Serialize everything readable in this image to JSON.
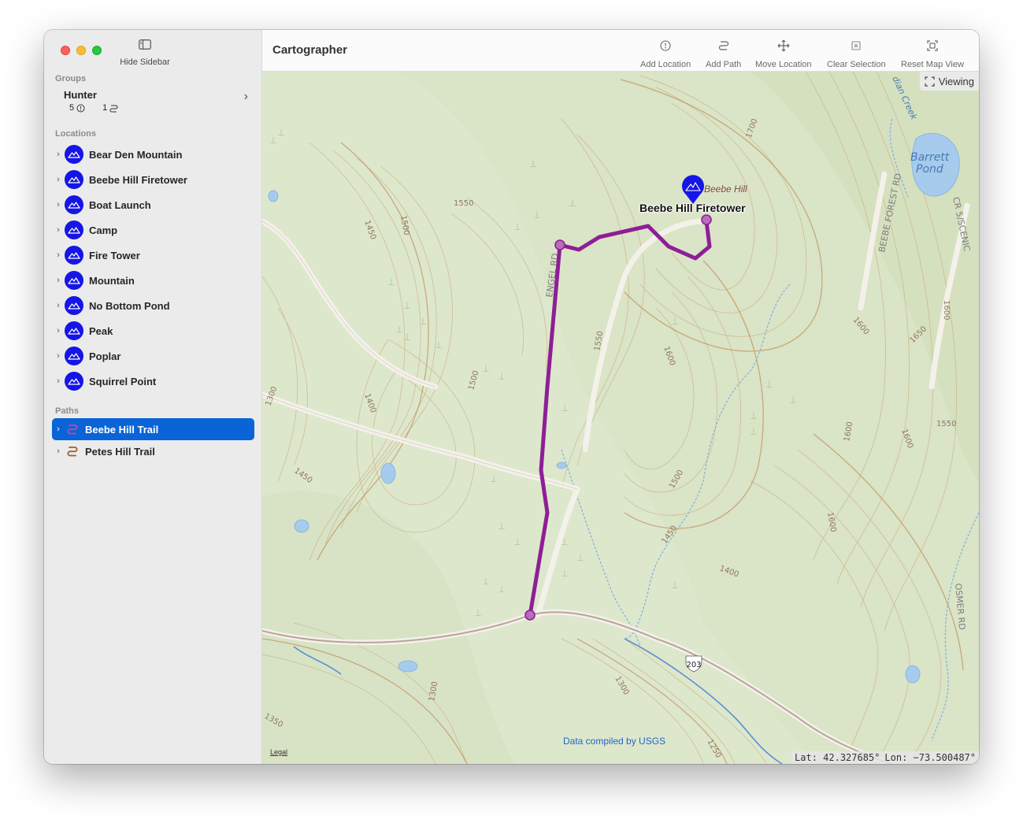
{
  "window": {
    "traffic_lights": [
      "close",
      "minimize",
      "zoom"
    ]
  },
  "sidebar": {
    "toggle_label": "Hide Sidebar",
    "groups_header": "Groups",
    "group": {
      "name": "Hunter",
      "location_count": "5",
      "path_count": "1"
    },
    "locations_header": "Locations",
    "locations": [
      {
        "label": "Bear Den Mountain"
      },
      {
        "label": "Beebe Hill Firetower"
      },
      {
        "label": "Boat Launch"
      },
      {
        "label": "Camp"
      },
      {
        "label": "Fire Tower"
      },
      {
        "label": "Mountain"
      },
      {
        "label": "No Bottom Pond"
      },
      {
        "label": "Peak"
      },
      {
        "label": "Poplar"
      },
      {
        "label": "Squirrel Point"
      }
    ],
    "paths_header": "Paths",
    "paths": [
      {
        "label": "Beebe Hill Trail",
        "selected": true
      },
      {
        "label": "Petes Hill Trail",
        "selected": false
      }
    ]
  },
  "toolbar": {
    "title": "Cartographer",
    "buttons": {
      "add_location": "Add Location",
      "add_path": "Add Path",
      "move_location": "Move Location",
      "clear_selection": "Clear Selection",
      "reset_map_view": "Reset Map View"
    }
  },
  "map": {
    "mode_badge": "Viewing",
    "pin_label": "Beebe Hill Firetower",
    "hill_label": "Beebe Hill",
    "attribution": "Data compiled by USGS",
    "legal": "Legal",
    "lat": "Lat:  42.327685°",
    "lon": "Lon:  −73.500487°",
    "route_shield": "203",
    "features": {
      "road_engel": "ENGEL RD",
      "road_beebe_forest": "BEEBE FOREST RD",
      "road_cr5": "CR 5/SCENIC",
      "road_osmer": "OSMER RD",
      "pond_barrett": "Barrett",
      "pond_barrett_2": "Pond",
      "creek": "dian Creek"
    },
    "contours": [
      "1700",
      "1550",
      "1450",
      "1500",
      "1500",
      "1550",
      "1600",
      "1600",
      "1650",
      "1600",
      "1550",
      "1600",
      "1600",
      "1400",
      "1300",
      "1450",
      "1500",
      "1450",
      "1400",
      "1600",
      "1300",
      "1300",
      "1250",
      "1350"
    ],
    "colors": {
      "trail": "#8e1e96",
      "pin": "#1515e6",
      "selection": "#0a64d8",
      "land": "#dfe8cf",
      "contour": "#c9a77a",
      "water": "#a6cbec"
    }
  }
}
